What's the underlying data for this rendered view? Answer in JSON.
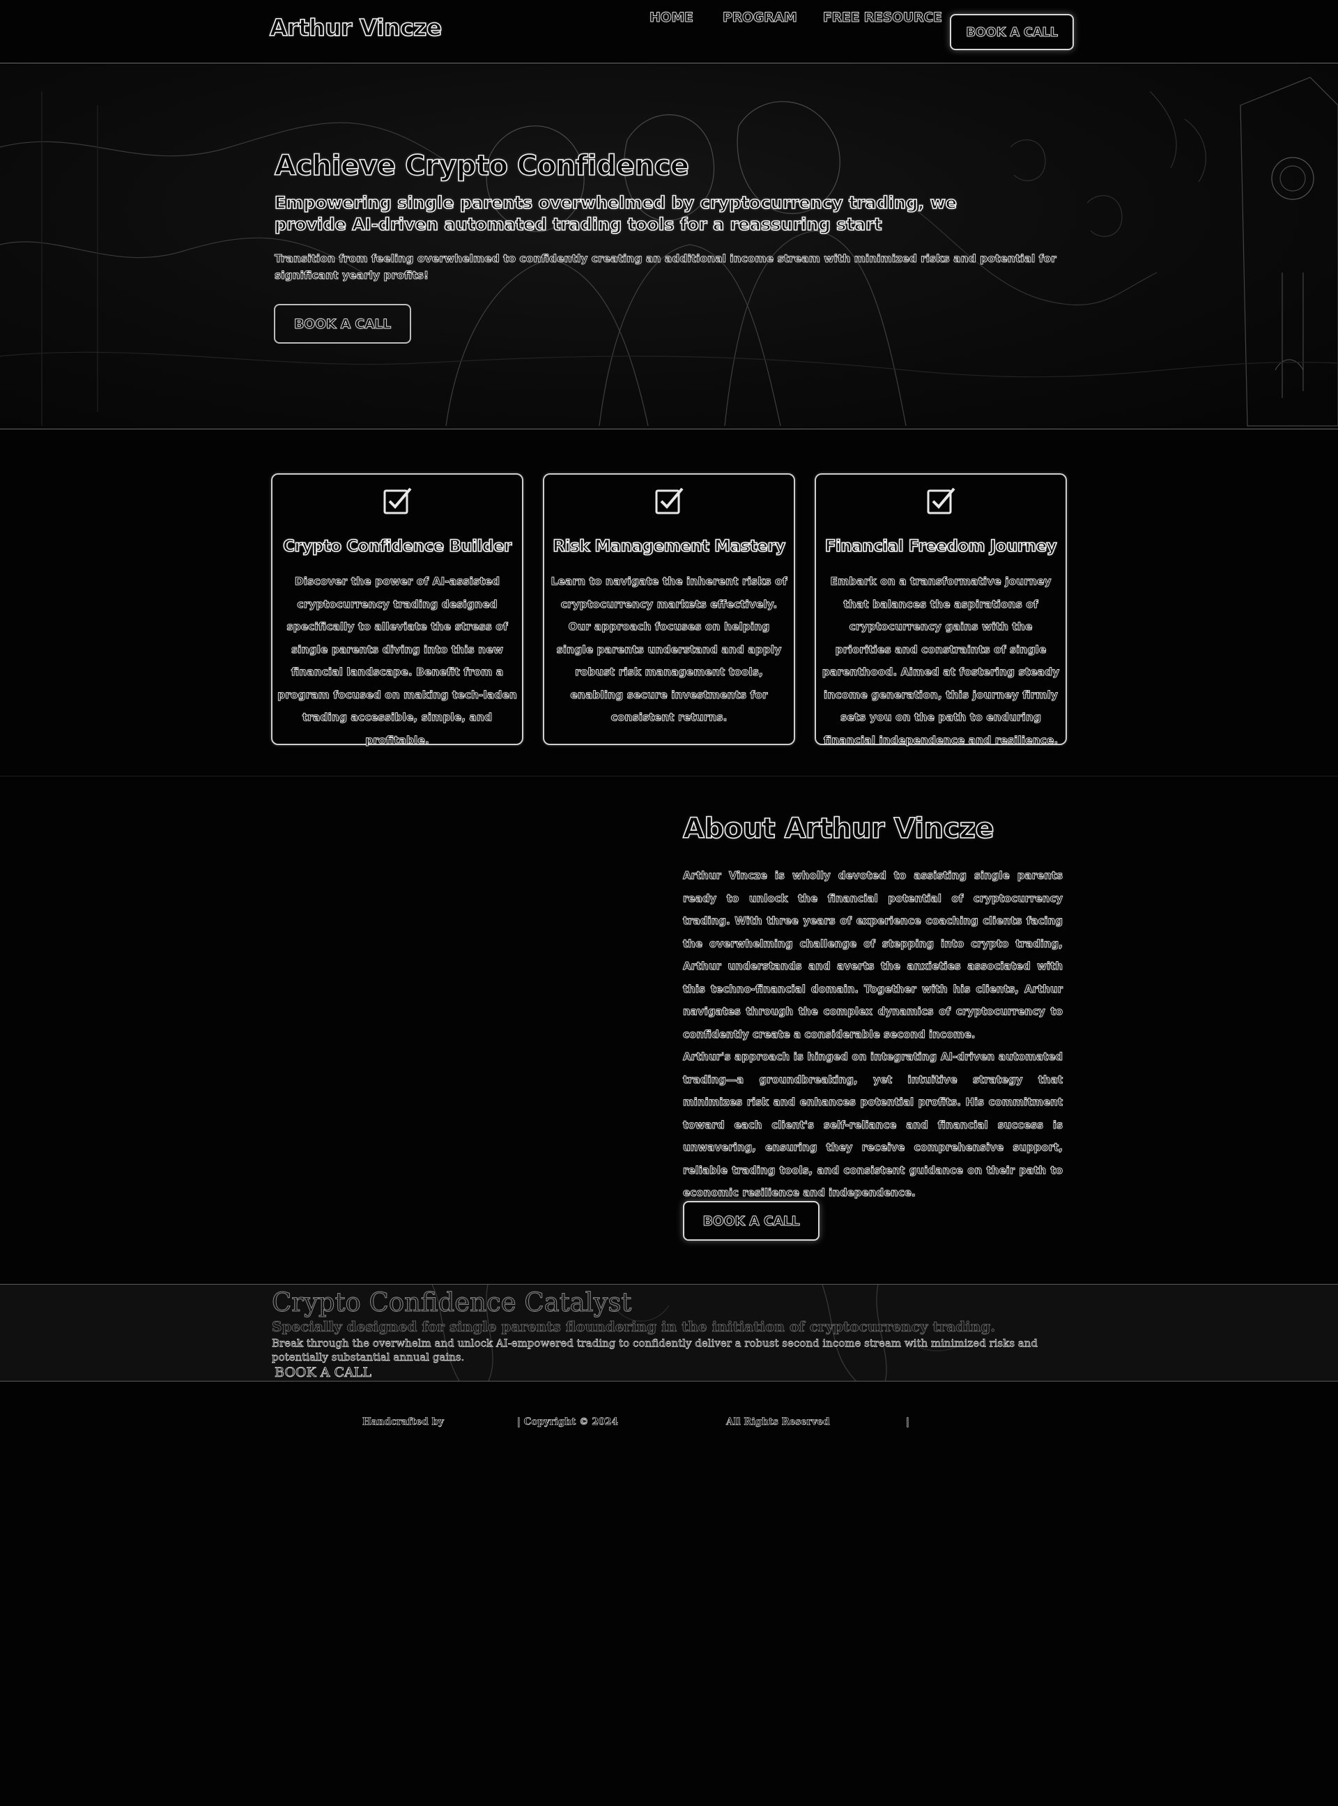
{
  "header": {
    "logo": "Arthur Vincze",
    "nav": [
      {
        "label": "HOME"
      },
      {
        "label": "PROGRAM"
      },
      {
        "label": "FREE RESOURCE"
      }
    ],
    "cta": "BOOK A CALL"
  },
  "hero": {
    "title": "Achieve Crypto Confidence",
    "subtitle": "Empowering single parents overwhelmed by cryptocurrency trading, we provide AI-driven automated trading tools for a reassuring start",
    "body": "Transition from feeling overwhelmed to confidently creating an additional income stream with minimized risks and potential for significant yearly profits!",
    "cta": "BOOK A CALL"
  },
  "features": [
    {
      "icon": "checkbox-icon",
      "title": "Crypto Confidence Builder",
      "text": "Discover the power of AI-assisted cryptocurrency trading designed specifically to alleviate the stress of single parents diving into this new financial landscape. Benefit from a program focused on making tech-laden trading accessible, simple, and profitable."
    },
    {
      "icon": "checkbox-icon",
      "title": "Risk Management Mastery",
      "text": "Learn to navigate the inherent risks of cryptocurrency markets effectively. Our approach focuses on helping single parents understand and apply robust risk management tools, enabling secure investments for consistent returns."
    },
    {
      "icon": "checkbox-icon",
      "title": "Financial Freedom Journey",
      "text": "Embark on a transformative journey that balances the aspirations of cryptocurrency gains with the priorities and constraints of single parenthood. Aimed at fostering steady income generation, this journey firmly sets you on the path to enduring financial independence and resilience."
    }
  ],
  "about": {
    "title": "About Arthur Vincze",
    "paragraphs": [
      "Arthur Vincze is wholly devoted to assisting single parents ready to unlock the financial potential of cryptocurrency trading. With three years of experience coaching clients facing the overwhelming challenge of stepping into crypto trading, Arthur understands and averts the anxieties associated with this techno-financial domain. Together with his clients, Arthur navigates through the complex dynamics of cryptocurrency to confidently create a considerable second income.",
      "Arthur's approach is hinged on integrating AI-driven automated trading—a groundbreaking, yet intuitive strategy that minimizes risk and enhances potential profits. His commitment toward each client's self-reliance and financial success is unwavering, ensuring they receive comprehensive support, reliable trading tools, and consistent guidance on their path to economic resilience and independence."
    ],
    "cta": "BOOK A CALL"
  },
  "catalyst": {
    "title": "Crypto Confidence Catalyst",
    "subtitle": "Specially designed for single parents floundering in the initiation of cryptocurrency trading.",
    "body": "Break through the overwhelm and unlock AI-empowered trading to confidently deliver a robust second income stream with minimized risks and potentially substantial annual gains.",
    "cta": "BOOK A CALL"
  },
  "footer": {
    "handcrafted": "Handcrafted by",
    "copyright": "| Copyright © 2024",
    "rights": "All Rights Reserved",
    "separator": "|"
  },
  "colors": {
    "background": "#030303",
    "outline": "#f2f2f2",
    "border": "#cfcfcf"
  }
}
